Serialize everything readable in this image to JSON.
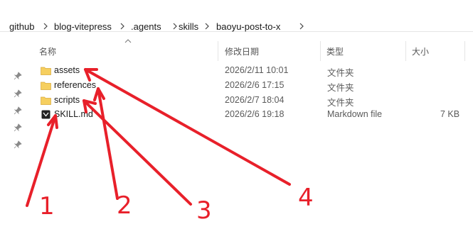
{
  "breadcrumb": [
    "github",
    "blog-vitepress",
    ".agents",
    "skills",
    "baoyu-post-to-x"
  ],
  "columns": {
    "name": "名称",
    "modified": "修改日期",
    "type": "类型",
    "size": "大小"
  },
  "files": [
    {
      "name": "assets",
      "modified": "2026/2/11 10:01",
      "type": "文件夹",
      "size": "",
      "icon": "folder-icon"
    },
    {
      "name": "references",
      "modified": "2026/2/6 17:15",
      "type": "文件夹",
      "size": "",
      "icon": "folder-icon"
    },
    {
      "name": "scripts",
      "modified": "2026/2/7 18:04",
      "type": "文件夹",
      "size": "",
      "icon": "folder-icon"
    },
    {
      "name": "SKILL.md",
      "modified": "2026/2/6 19:18",
      "type": "Markdown file",
      "size": "7 KB",
      "icon": "markdown-file-icon"
    }
  ],
  "annotations": [
    "1",
    "2",
    "3",
    "4"
  ],
  "colors": {
    "annotation": "#e8202a",
    "folder": "#f6cf5f",
    "breadcrumb_border": "#e5e5e5"
  }
}
